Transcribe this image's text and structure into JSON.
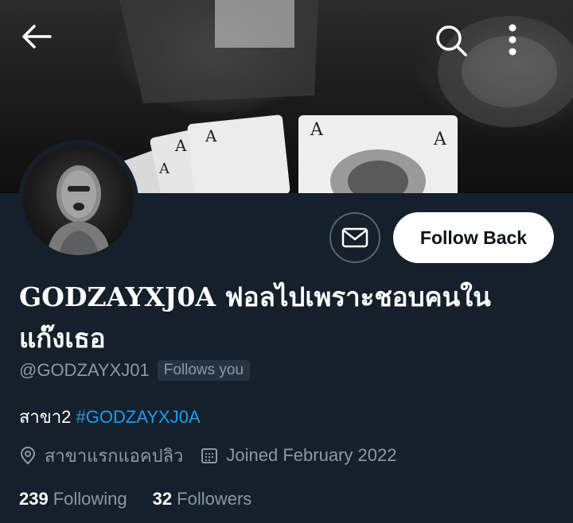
{
  "header": {
    "back_icon": "arrow-left-icon",
    "search_icon": "search-icon",
    "more_icon": "more-vertical-icon"
  },
  "profile": {
    "display_name": "GODZAYXJ0A ฟอลไปเพราะชอบคนในแก๊งเธอ",
    "handle": "@GODZAYXJ01",
    "follows_you": "Follows you",
    "bio_text": "สาขา2 ",
    "bio_hashtag": "#GODZAYXJ0A",
    "location": "สาขาแรกแอคปลิว",
    "joined": "Joined February 2022",
    "following_count": "239",
    "following_label": "Following",
    "followers_count": "32",
    "followers_label": "Followers"
  },
  "actions": {
    "message_icon": "envelope-icon",
    "follow_back_label": "Follow Back"
  },
  "colors": {
    "background": "#15202b",
    "secondary_text": "#8b98a5",
    "link": "#1d9bf0",
    "button_bg": "#ffffff"
  }
}
